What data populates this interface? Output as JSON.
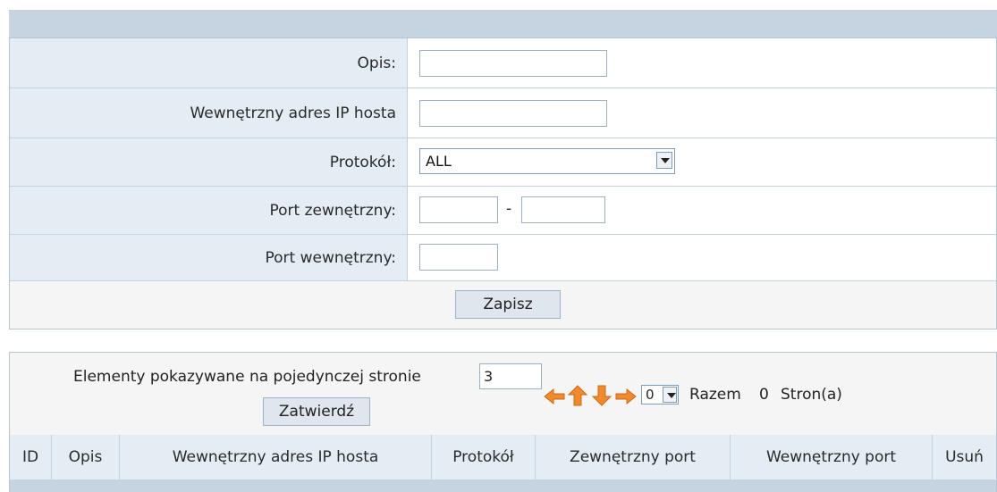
{
  "form": {
    "description_label": "Opis:",
    "description_value": "",
    "host_ip_label": "Wewnętrzny adres IP hosta",
    "host_ip_value": "",
    "protocol_label": "Protokół:",
    "protocol_value": "ALL",
    "external_port_label": "Port zewnętrzny:",
    "external_port_from": "",
    "external_port_separator": "-",
    "external_port_to": "",
    "internal_port_label": "Port wewnętrzny:",
    "internal_port_value": "",
    "save_button": "Zapisz"
  },
  "list": {
    "per_page_label": "Elementy pokazywane na pojedynczej stronie",
    "per_page_value": "3",
    "confirm_button": "Zatwierdź",
    "page_select_value": "0",
    "total_label": "Razem",
    "total_value": "0",
    "pages_label": "Stron(a)",
    "nav_icons": [
      "first-page-icon",
      "previous-page-icon",
      "next-page-icon",
      "last-page-icon"
    ],
    "nav_icon_color": "#f08a2c",
    "columns": [
      "ID",
      "Opis",
      "Wewnętrzny adres IP hosta",
      "Protokół",
      "Zewnętrzny port",
      "Wewnętrzny port",
      "Usuń"
    ]
  },
  "colors": {
    "header_bar": "#c6d4e2",
    "label_cell": "#e5edf4",
    "border": "#c5d1dd"
  }
}
